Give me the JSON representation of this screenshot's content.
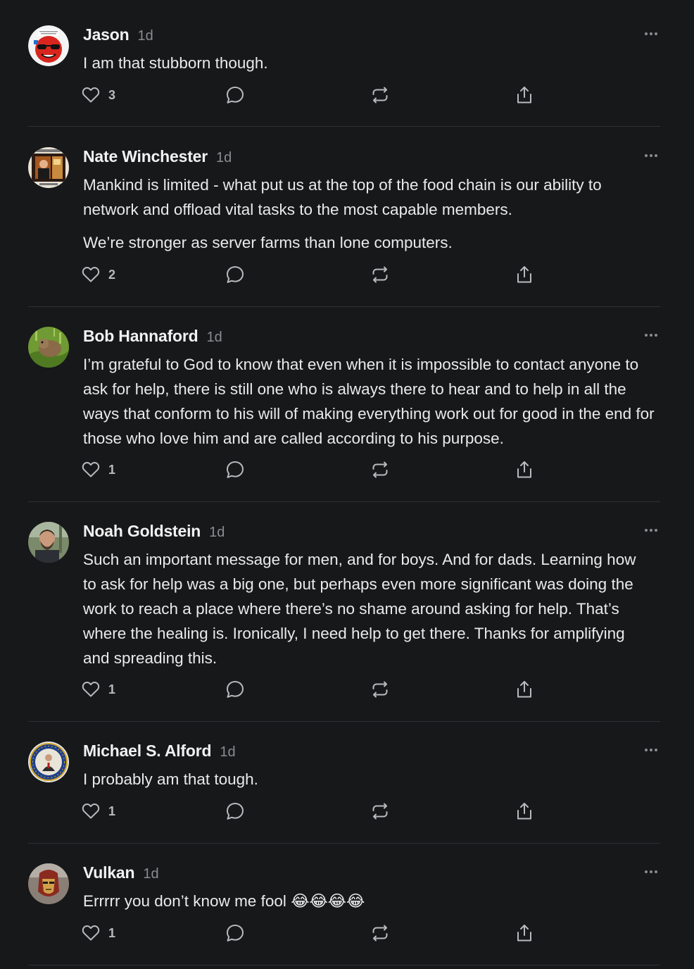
{
  "comments": [
    {
      "author": "Jason",
      "time": "1d",
      "paragraphs": [
        "I am that stubborn though."
      ],
      "likes": "3",
      "avatar": "red-sunglasses-face"
    },
    {
      "author": "Nate Winchester",
      "time": "1d",
      "paragraphs": [
        "Mankind is limited - what put us at the top of the food chain is our ability to network and offload vital tasks to the most capable members.",
        "We’re stronger as server farms than lone computers."
      ],
      "likes": "2",
      "avatar": "framed-portrait"
    },
    {
      "author": "Bob Hannaford",
      "time": "1d",
      "paragraphs": [
        "I’m grateful to God to know that even when it is impossible to contact anyone to ask for help, there is still one who is always there to hear and to help in all the ways that conform to his will of making everything work out for good in the end for those who love him and are called according to his purpose."
      ],
      "likes": "1",
      "avatar": "groundhog-on-grass"
    },
    {
      "author": "Noah Goldstein",
      "time": "1d",
      "paragraphs": [
        "Such an important message for men, and for boys. And for dads. Learning how to ask for help was a big one, but perhaps even more significant was doing the work to reach a place where there’s no shame around asking for help. That’s where the healing is. Ironically, I need help to get there. Thanks for amplifying and spreading this."
      ],
      "likes": "1",
      "avatar": "bearded-man-photo"
    },
    {
      "author": "Michael S. Alford",
      "time": "1d",
      "paragraphs": [
        "I probably am that tough."
      ],
      "likes": "1",
      "avatar": "seal-emblem"
    },
    {
      "author": "Vulkan",
      "time": "1d",
      "paragraphs": [
        "Errrrr you don’t know me fool 😂😂😂😂"
      ],
      "likes": "1",
      "avatar": "armored-helmet"
    }
  ],
  "icons": {
    "like": "heart-icon",
    "reply": "comment-bubble-icon",
    "restack": "restack-icon",
    "share": "share-icon",
    "more": "more-options-icon"
  },
  "colors": {
    "background": "#17181a",
    "text": "#eaeaea",
    "muted": "#8b8c90",
    "icon": "#b9babd",
    "divider": "#2f3033"
  }
}
